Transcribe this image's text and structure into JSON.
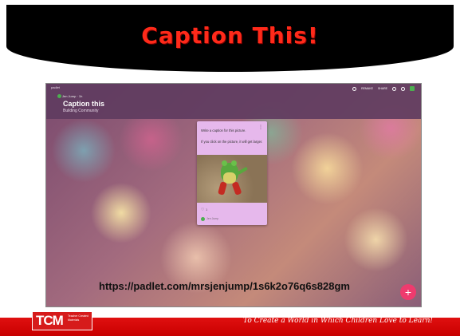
{
  "slide": {
    "title": "Caption This!",
    "url": "https://padlet.com/mrsjenjump/1s6k2o76q6s828gm"
  },
  "padlet": {
    "logo": "padlet",
    "author": "Jen Jump · 1h",
    "title": "Caption this",
    "subtitle": "Building Community",
    "topbar": {
      "remake": "REMAKE",
      "share": "SHARE"
    },
    "post": {
      "menu": "⋮",
      "line1": "Write a caption for this picture.",
      "line2": "If you click on the picture, it will get larger.",
      "likes": "1",
      "author": "Jen Jump"
    },
    "fab": "+"
  },
  "footer": {
    "logo": "TCM",
    "logo_sub": "Teacher Created Materials",
    "tagline": "To Create a World in Which Children Love to Learn!"
  }
}
